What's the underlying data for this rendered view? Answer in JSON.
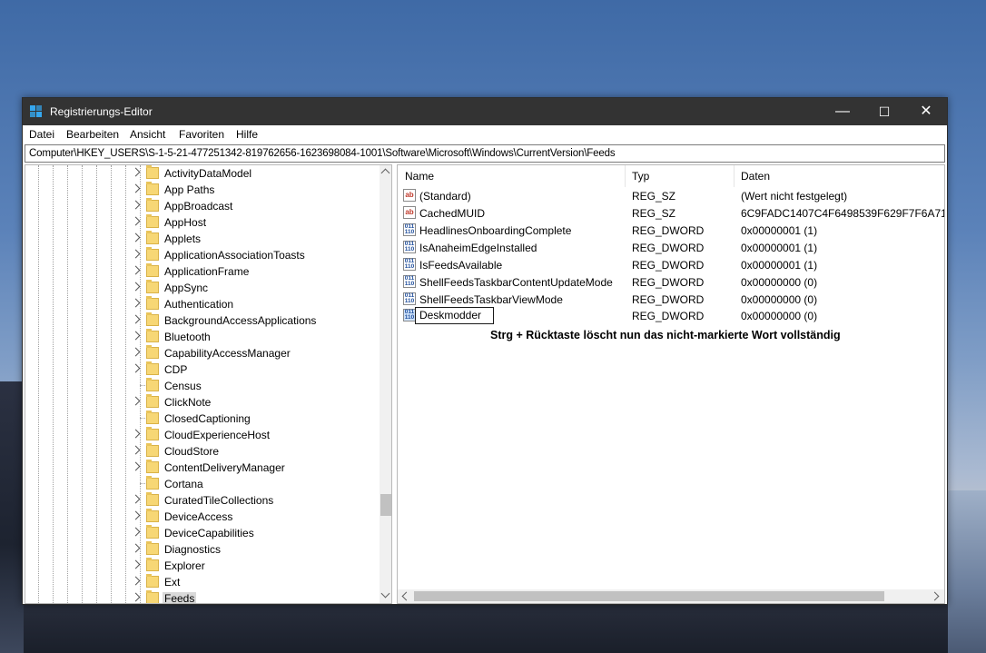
{
  "window": {
    "title": "Registrierungs-Editor",
    "minimize": "—",
    "maximize": "☐",
    "close": "✕"
  },
  "menu": [
    "Datei",
    "Bearbeiten",
    "Ansicht",
    "Favoriten",
    "Hilfe"
  ],
  "address": "Computer\\HKEY_USERS\\S-1-5-21-477251342-819762656-1623698084-1001\\Software\\Microsoft\\Windows\\CurrentVersion\\Feeds",
  "tree": {
    "items": [
      {
        "label": "ActivityDataModel",
        "expandable": true
      },
      {
        "label": "App Paths",
        "expandable": true
      },
      {
        "label": "AppBroadcast",
        "expandable": true
      },
      {
        "label": "AppHost",
        "expandable": true
      },
      {
        "label": "Applets",
        "expandable": true
      },
      {
        "label": "ApplicationAssociationToasts",
        "expandable": true
      },
      {
        "label": "ApplicationFrame",
        "expandable": true
      },
      {
        "label": "AppSync",
        "expandable": true
      },
      {
        "label": "Authentication",
        "expandable": true
      },
      {
        "label": "BackgroundAccessApplications",
        "expandable": true
      },
      {
        "label": "Bluetooth",
        "expandable": true
      },
      {
        "label": "CapabilityAccessManager",
        "expandable": true
      },
      {
        "label": "CDP",
        "expandable": true
      },
      {
        "label": "Census",
        "expandable": false
      },
      {
        "label": "ClickNote",
        "expandable": true
      },
      {
        "label": "ClosedCaptioning",
        "expandable": false
      },
      {
        "label": "CloudExperienceHost",
        "expandable": true
      },
      {
        "label": "CloudStore",
        "expandable": true
      },
      {
        "label": "ContentDeliveryManager",
        "expandable": true
      },
      {
        "label": "Cortana",
        "expandable": false
      },
      {
        "label": "CuratedTileCollections",
        "expandable": true
      },
      {
        "label": "DeviceAccess",
        "expandable": true
      },
      {
        "label": "DeviceCapabilities",
        "expandable": true
      },
      {
        "label": "Diagnostics",
        "expandable": true
      },
      {
        "label": "Explorer",
        "expandable": true
      },
      {
        "label": "Ext",
        "expandable": true
      },
      {
        "label": "Feeds",
        "expandable": true,
        "selected": true
      }
    ]
  },
  "list": {
    "headers": {
      "name": "Name",
      "type": "Typ",
      "data": "Daten"
    },
    "rows": [
      {
        "icon": "ab",
        "name": "(Standard)",
        "type": "REG_SZ",
        "data": "(Wert nicht festgelegt)"
      },
      {
        "icon": "ab",
        "name": "CachedMUID",
        "type": "REG_SZ",
        "data": "6C9FADC1407C4F6498539F629F7F6A71"
      },
      {
        "icon": "dw",
        "name": "HeadlinesOnboardingComplete",
        "type": "REG_DWORD",
        "data": "0x00000001 (1)"
      },
      {
        "icon": "dw",
        "name": "IsAnaheimEdgeInstalled",
        "type": "REG_DWORD",
        "data": "0x00000001 (1)"
      },
      {
        "icon": "dw",
        "name": "IsFeedsAvailable",
        "type": "REG_DWORD",
        "data": "0x00000001 (1)"
      },
      {
        "icon": "dw",
        "name": "ShellFeedsTaskbarContentUpdateMode",
        "type": "REG_DWORD",
        "data": "0x00000000 (0)"
      },
      {
        "icon": "dw",
        "name": "ShellFeedsTaskbarViewMode",
        "type": "REG_DWORD",
        "data": "0x00000000 (0)"
      }
    ],
    "editing_row": {
      "value": "Deskmodder",
      "type": "REG_DWORD",
      "data": "0x00000000 (0)"
    }
  },
  "annotation": "Strg + Rücktaste löscht nun das nicht-markierte Wort vollständig",
  "icons": {
    "sz_glyph": "ab",
    "dw_glyph": "011\n110"
  },
  "colors": {
    "titlebar": "#333333",
    "accent_icon": "#35a7ee",
    "folder": "#f7d775"
  }
}
